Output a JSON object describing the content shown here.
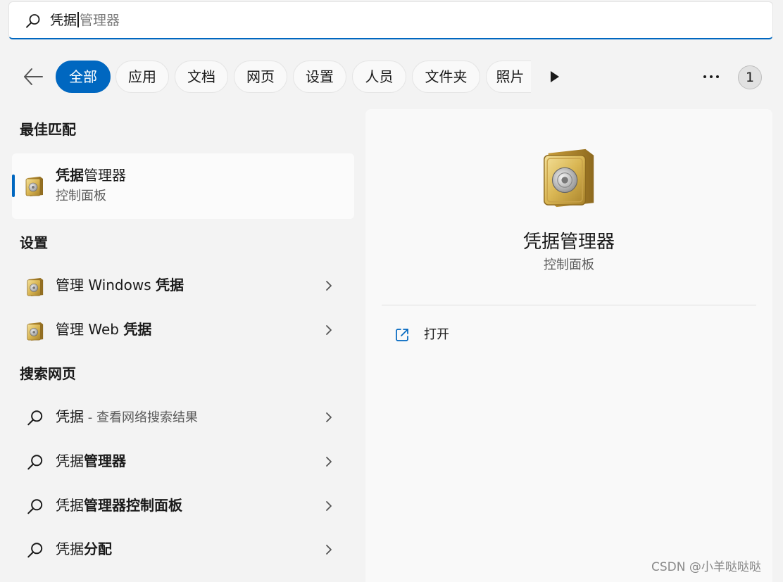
{
  "search": {
    "typed": "凭据",
    "suggestion": "管理器"
  },
  "filters": {
    "back_icon": "arrow-left-icon",
    "chips": [
      "全部",
      "应用",
      "文档",
      "网页",
      "设置",
      "人员",
      "文件夹",
      "照片"
    ],
    "active_index": 0,
    "more_icon": "ellipsis-icon",
    "scroll_icon": "play-triangle-icon",
    "badge": "1"
  },
  "best_match": {
    "heading": "最佳匹配",
    "item": {
      "title_bold": "凭据",
      "title_rest": "管理器",
      "subtitle": "控制面板",
      "icon": "vault-icon"
    }
  },
  "settings": {
    "heading": "设置",
    "items": [
      {
        "prefix": "管理 Windows ",
        "bold": "凭据",
        "icon": "vault-icon"
      },
      {
        "prefix": "管理 Web ",
        "bold": "凭据",
        "icon": "vault-icon"
      }
    ]
  },
  "web_search": {
    "heading": "搜索网页",
    "items": [
      {
        "normal": "凭据",
        "bold": "",
        "hint": " - 查看网络搜索结果"
      },
      {
        "normal": "凭据",
        "bold": "管理器",
        "hint": ""
      },
      {
        "normal": "凭据",
        "bold": "管理器控制面板",
        "hint": ""
      },
      {
        "normal": "凭据",
        "bold": "分配",
        "hint": ""
      }
    ]
  },
  "preview": {
    "title": "凭据管理器",
    "subtitle": "控制面板",
    "action_label": "打开",
    "action_icon": "open-external-icon"
  },
  "watermark": "CSDN @小羊哒哒哒",
  "colors": {
    "accent": "#0067c0",
    "background": "#f3f3f3",
    "panel": "#f9f9f9"
  }
}
